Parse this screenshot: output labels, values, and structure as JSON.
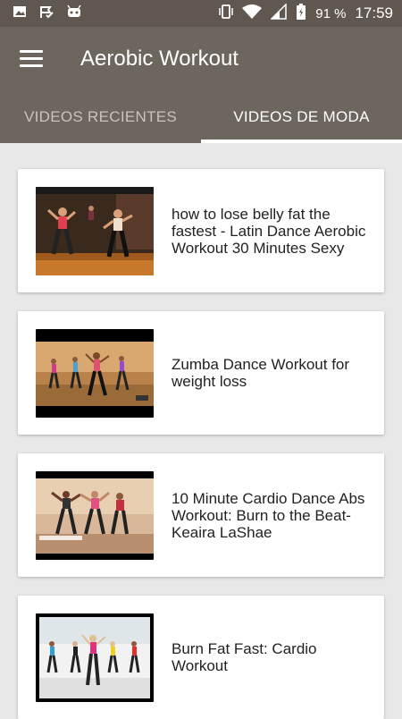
{
  "status_bar": {
    "battery": "91 %",
    "time": "17:59",
    "icons": [
      "image-icon",
      "check-flag-icon",
      "android-robot-icon",
      "vibrate-icon",
      "wifi-icon",
      "signal-icon",
      "battery-charging-icon"
    ]
  },
  "app_bar": {
    "title": "Aerobic Workout",
    "menu_icon": "hamburger-menu-icon"
  },
  "tabs": [
    {
      "label": "VIDEOS RECIENTES",
      "active": false
    },
    {
      "label": "VIDEOS DE MODA",
      "active": true
    }
  ],
  "videos": [
    {
      "title": "how to lose belly fat the fastest - Latin Dance Aerobic Workout  30 Minutes Sexy"
    },
    {
      "title": "Zumba Dance Workout for weight loss"
    },
    {
      "title": "10 Minute Cardio Dance Abs Workout: Burn to the Beat- Keaira LaShae"
    },
    {
      "title": "Burn Fat Fast: Cardio Workout"
    }
  ],
  "colors": {
    "status_bar": "#5f5750",
    "app_bar": "#6d665e",
    "background": "#e8e8e8"
  }
}
